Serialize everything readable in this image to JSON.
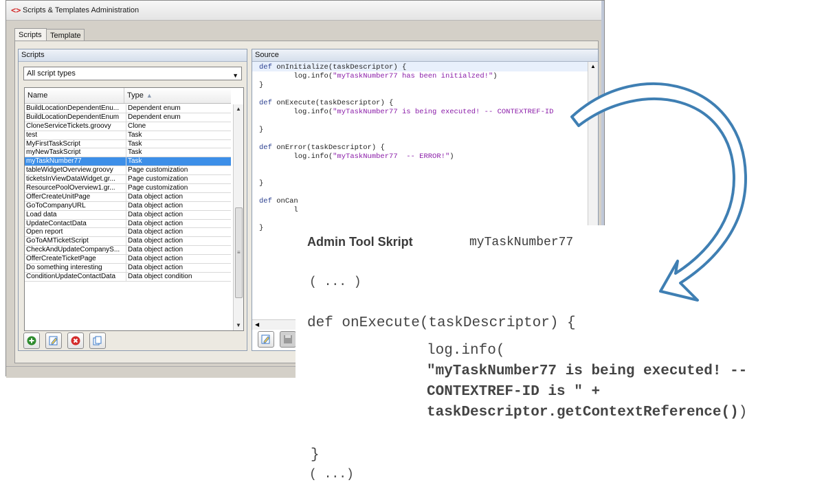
{
  "window": {
    "title": "Scripts & Templates Administration",
    "tabs": [
      {
        "label": "Scripts",
        "active": true
      },
      {
        "label": "Template",
        "active": false
      }
    ]
  },
  "scripts_panel": {
    "header": "Scripts",
    "filter_value": "All script types",
    "columns": [
      "Name",
      "Type"
    ],
    "sort_column": "Type",
    "rows": [
      {
        "name": "BuildLocationDependentEnu...",
        "type": "Dependent enum"
      },
      {
        "name": "BuildLocationDependentEnum",
        "type": "Dependent enum"
      },
      {
        "name": "CloneServiceTickets.groovy",
        "type": "Clone"
      },
      {
        "name": "test",
        "type": "Task"
      },
      {
        "name": "MyFirstTaskScript",
        "type": "Task"
      },
      {
        "name": "myNewTaskScript",
        "type": "Task"
      },
      {
        "name": "myTaskNumber77",
        "type": "Task",
        "selected": true
      },
      {
        "name": "tableWidgetOverview.groovy",
        "type": "Page customization"
      },
      {
        "name": "ticketsInViewDataWidget.gr...",
        "type": "Page customization"
      },
      {
        "name": "ResourcePoolOverview1.gr...",
        "type": "Page customization"
      },
      {
        "name": "OfferCreateUnitPage",
        "type": "Data object action"
      },
      {
        "name": "GoToCompanyURL",
        "type": "Data object action"
      },
      {
        "name": "Load data",
        "type": "Data object action"
      },
      {
        "name": "UpdateContactData",
        "type": "Data object action"
      },
      {
        "name": "Open report",
        "type": "Data object action"
      },
      {
        "name": "GoToAMTicketScript",
        "type": "Data object action"
      },
      {
        "name": "CheckAndUpdateCompanyS...",
        "type": "Data object action"
      },
      {
        "name": "OfferCreateTicketPage",
        "type": "Data object action"
      },
      {
        "name": "Do something interesting",
        "type": "Data object action"
      },
      {
        "name": "ConditionUpdateContactData",
        "type": "Data object condition"
      }
    ],
    "buttons": [
      {
        "name": "add",
        "icon": "plus-icon",
        "color": "#2e8b2e"
      },
      {
        "name": "edit",
        "icon": "edit-icon",
        "color": "#3a78c8"
      },
      {
        "name": "delete",
        "icon": "delete-icon",
        "color": "#d42b2b"
      },
      {
        "name": "copy",
        "icon": "copy-icon",
        "color": "#3a78c8"
      }
    ]
  },
  "source_panel": {
    "header": "Source",
    "lines": [
      {
        "kw": "def ",
        "text": "onInitialize(taskDescriptor) {",
        "str": ""
      },
      {
        "kw": "",
        "text": "        log.info(",
        "str": "\"myTaskNumber77 has been initialzed!\"",
        "tail": ")"
      },
      {
        "kw": "",
        "text": "}",
        "str": ""
      },
      {
        "kw": "",
        "text": "",
        "str": ""
      },
      {
        "kw": "def ",
        "text": "onExecute(taskDescriptor) {",
        "str": ""
      },
      {
        "kw": "",
        "text": "        log.info(",
        "str": "\"myTaskNumber77 is being executed! -- CONTEXTREF-ID",
        "tail": ""
      },
      {
        "kw": "",
        "text": "",
        "str": ""
      },
      {
        "kw": "",
        "text": "}",
        "str": ""
      },
      {
        "kw": "",
        "text": "",
        "str": ""
      },
      {
        "kw": "def ",
        "text": "onError(taskDescriptor) {",
        "str": ""
      },
      {
        "kw": "",
        "text": "        log.info(",
        "str": "\"myTaskNumber77  -- ERROR!\"",
        "tail": ")"
      },
      {
        "kw": "",
        "text": "",
        "str": ""
      },
      {
        "kw": "",
        "text": "",
        "str": ""
      },
      {
        "kw": "",
        "text": "}",
        "str": ""
      },
      {
        "kw": "",
        "text": "",
        "str": ""
      },
      {
        "kw": "def ",
        "text": "onCan",
        "str": ""
      },
      {
        "kw": "",
        "text": "        l",
        "str": ""
      },
      {
        "kw": "",
        "text": "",
        "str": ""
      },
      {
        "kw": "",
        "text": "}",
        "str": ""
      }
    ]
  },
  "card": {
    "title": "Admin Tool Skript",
    "script_name": "myTaskNumber77",
    "ellipsis_top": "( ... )",
    "def_line": "def onExecute(taskDescriptor) {",
    "log_line": "log.info(",
    "str_line1": "\"myTaskNumber77 is being executed! --",
    "str_line2": "CONTEXTREF-ID is \" +",
    "call_line": "taskDescriptor.getContextReference()",
    "call_close": ")",
    "close_brace": "}",
    "ellipsis_bottom": "( ...)"
  },
  "colors": {
    "arrow": "#3f7fb3",
    "selection": "#3d8fe8"
  }
}
